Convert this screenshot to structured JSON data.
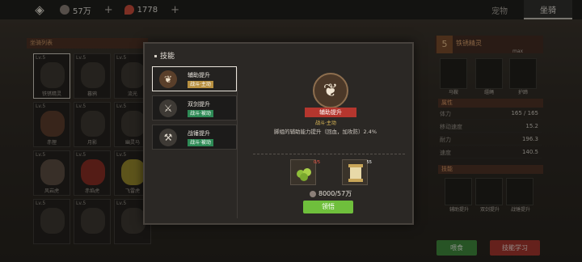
{
  "topbar": {
    "logo_icon": "diamond-logo-icon",
    "resource1": {
      "icon": "coin-icon",
      "value": "57万",
      "color": "#8c8079"
    },
    "resource2": {
      "icon": "gem-icon",
      "value": "1778",
      "color": "#d04a3a"
    },
    "plus": "+",
    "tabs": [
      {
        "label": "宠物",
        "active": false
      },
      {
        "label": "坐骑",
        "active": true
      }
    ]
  },
  "left": {
    "title": "坐骑列表",
    "mounts": [
      {
        "level": "Lv.5",
        "name": "铁锈精灵",
        "selected": true
      },
      {
        "level": "Lv.5",
        "name": "暮鸦"
      },
      {
        "level": "Lv.5",
        "name": "流光"
      },
      {
        "level": "Lv.5",
        "name": "赤狸"
      },
      {
        "level": "Lv.5",
        "name": "月影"
      },
      {
        "level": "Lv.5",
        "name": "幽灵马"
      },
      {
        "level": "Lv.5",
        "name": "风岩虎"
      },
      {
        "level": "Lv.5",
        "name": "赤焰虎"
      },
      {
        "level": "Lv.5",
        "name": "飞雷虎"
      },
      {
        "level": "Lv.5",
        "name": ""
      },
      {
        "level": "Lv.5",
        "name": ""
      },
      {
        "level": "Lv.5",
        "name": ""
      }
    ]
  },
  "right": {
    "level": "5",
    "name": "铁锈精灵",
    "max": "max",
    "equips": [
      {
        "label": "马鞍"
      },
      {
        "label": "缰绳"
      },
      {
        "label": "护蹄"
      }
    ],
    "attr_title": "属性",
    "stats": [
      {
        "label": "体力",
        "value": "165 / 165"
      },
      {
        "label": "移动速度",
        "value": "15.2"
      },
      {
        "label": "耐力",
        "value": "196.3"
      },
      {
        "label": "速度",
        "value": "140.5"
      }
    ],
    "skill_title": "技能",
    "skills": [
      {
        "label": "辅助提升"
      },
      {
        "label": "双剑提升"
      },
      {
        "label": "战锤提升"
      }
    ],
    "btn_feed": "喂食",
    "btn_learn": "技能学习"
  },
  "modal": {
    "title": "技能",
    "skills": [
      {
        "name": "辅助提升",
        "tag": "战斗·主动",
        "selected": true
      },
      {
        "name": "双剑提升",
        "tag": "战斗·被动",
        "selected": false
      },
      {
        "name": "战锤提升",
        "tag": "战斗·被动",
        "selected": false
      }
    ],
    "detail": {
      "name": "辅助提升",
      "tag": "战斗·主动",
      "description": "脚组的辅助能力提升（回血，加攻防）2.4%"
    },
    "materials": [
      {
        "icon": "fruit-icon",
        "count": "0/5"
      },
      {
        "icon": "scroll-icon",
        "count": "55"
      }
    ],
    "cost": "8000/57万",
    "learn_button": "领悟"
  }
}
